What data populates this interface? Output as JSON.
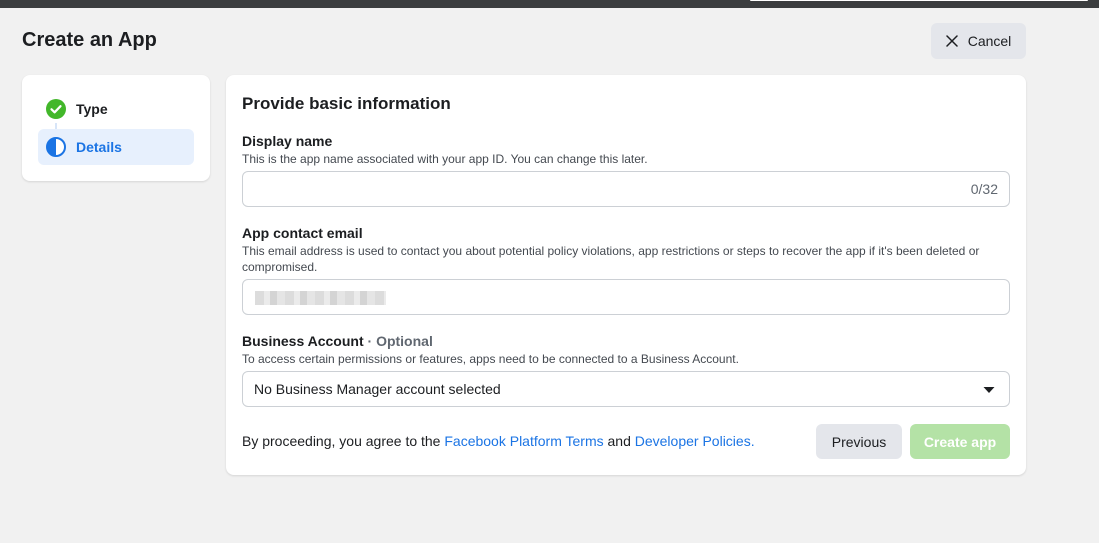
{
  "header": {
    "title": "Create an App",
    "cancel_label": "Cancel"
  },
  "steps": [
    {
      "label": "Type",
      "status": "complete",
      "icon": "check-circle-icon"
    },
    {
      "label": "Details",
      "status": "current",
      "icon": "half-circle-icon"
    }
  ],
  "form": {
    "section_title": "Provide basic information",
    "display_name": {
      "label": "Display name",
      "help": "This is the app name associated with your app ID. You can change this later.",
      "value": "",
      "counter": "0/32"
    },
    "contact_email": {
      "label": "App contact email",
      "help": "This email address is used to contact you about potential policy violations, app restrictions or steps to recover the app if it's been deleted or compromised."
    },
    "business_account": {
      "label": "Business Account",
      "optional": "· Optional",
      "help": "To access certain permissions or features, apps need to be connected to a Business Account.",
      "selected": "No Business Manager account selected"
    },
    "consent": {
      "prefix": "By proceeding, you agree to the",
      "terms_link": "Facebook Platform Terms",
      "and": "and",
      "policies_link": "Developer Policies."
    },
    "previous_label": "Previous",
    "create_label": "Create app"
  },
  "colors": {
    "accent": "#1b74e4",
    "success": "#42b72a",
    "create_disabled": "#b4e2a6"
  }
}
